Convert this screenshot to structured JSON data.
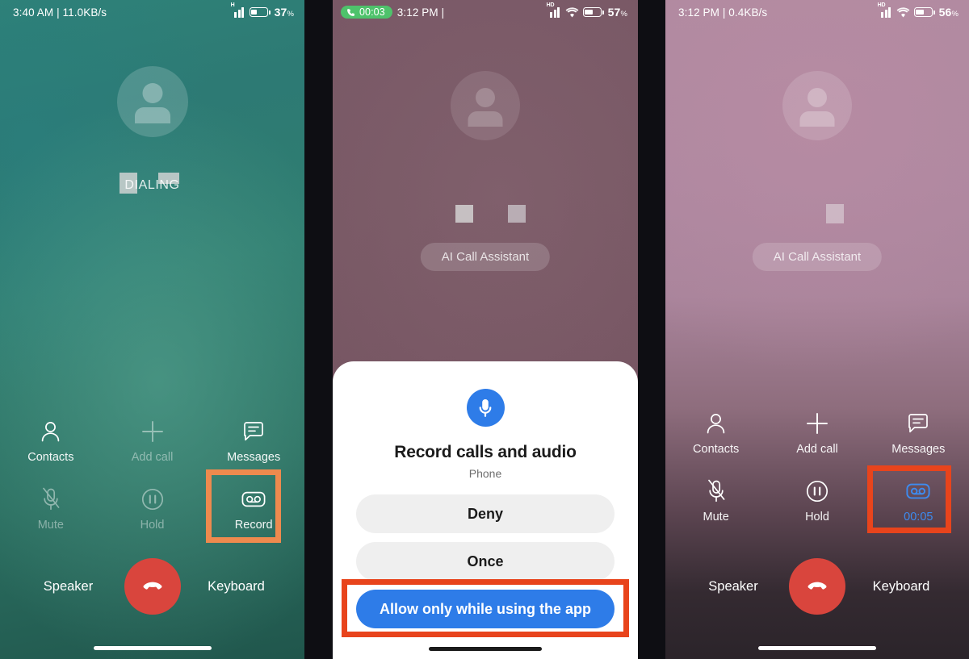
{
  "panels": [
    {
      "id": "dialing-call-screen",
      "status_bar": {
        "time_and_speed": "3:40 AM | 11.0KB/s",
        "battery_percent": "37",
        "percent_symbol": "%",
        "signal_icon": "signal-bars-icon",
        "signal_label": "H",
        "battery_icon": "battery-icon"
      },
      "avatar_icon": "contact-avatar-icon",
      "call_status": "DIALING",
      "controls": [
        {
          "label": "Contacts",
          "icon": "contacts-person-icon",
          "state": "enabled"
        },
        {
          "label": "Add call",
          "icon": "add-call-plus-icon",
          "state": "disabled"
        },
        {
          "label": "Messages",
          "icon": "messages-bubble-icon",
          "state": "enabled"
        },
        {
          "label": "Mute",
          "icon": "mute-microphone-slash-icon",
          "state": "disabled"
        },
        {
          "label": "Hold",
          "icon": "hold-pause-icon",
          "state": "disabled"
        },
        {
          "label": "Record",
          "icon": "record-voicemail-icon",
          "state": "highlighted"
        }
      ],
      "speaker_label": "Speaker",
      "keyboard_label": "Keyboard",
      "end_call_icon": "end-call-handset-icon",
      "highlight_color": "#ee8a4e"
    },
    {
      "id": "permission-dialog-screen",
      "status_bar": {
        "call_timer": "00:03",
        "call_icon": "active-call-handset-icon",
        "time_and_speed": "3:12 PM |",
        "battery_percent": "57",
        "percent_symbol": "%",
        "signal_icon": "signal-bars-icon",
        "signal_label": "HD",
        "wifi_icon": "wifi-icon",
        "battery_icon": "battery-icon"
      },
      "avatar_icon": "contact-avatar-icon",
      "redacted_name": true,
      "ai_chip_label": "AI Call Assistant",
      "dialog": {
        "icon": "microphone-icon",
        "title": "Record calls and audio",
        "subtitle": "Phone",
        "buttons": [
          {
            "label": "Deny",
            "kind": "secondary"
          },
          {
            "label": "Once",
            "kind": "secondary"
          },
          {
            "label": "Allow only while using the app",
            "kind": "primary",
            "highlighted": true
          }
        ]
      },
      "highlight_color": "#e8441c"
    },
    {
      "id": "recording-active-call-screen",
      "status_bar": {
        "time_and_speed": "3:12 PM | 0.4KB/s",
        "battery_percent": "56",
        "percent_symbol": "%",
        "signal_icon": "signal-bars-icon",
        "signal_label": "HD",
        "wifi_icon": "wifi-icon",
        "battery_icon": "battery-icon"
      },
      "avatar_icon": "contact-avatar-icon",
      "redacted_name": true,
      "ai_chip_label": "AI Call Assistant",
      "controls": [
        {
          "label": "Contacts",
          "icon": "contacts-person-icon",
          "state": "enabled"
        },
        {
          "label": "Add call",
          "icon": "add-call-plus-icon",
          "state": "enabled"
        },
        {
          "label": "Messages",
          "icon": "messages-bubble-icon",
          "state": "enabled"
        },
        {
          "label": "Mute",
          "icon": "mute-microphone-slash-icon",
          "state": "enabled"
        },
        {
          "label": "Hold",
          "icon": "hold-pause-icon",
          "state": "enabled"
        },
        {
          "label": "00:05",
          "icon": "record-voicemail-icon",
          "state": "recording"
        }
      ],
      "speaker_label": "Speaker",
      "keyboard_label": "Keyboard",
      "end_call_icon": "end-call-handset-icon",
      "recording_accent": "#3d8bf0",
      "highlight_color": "#e8441c"
    }
  ]
}
